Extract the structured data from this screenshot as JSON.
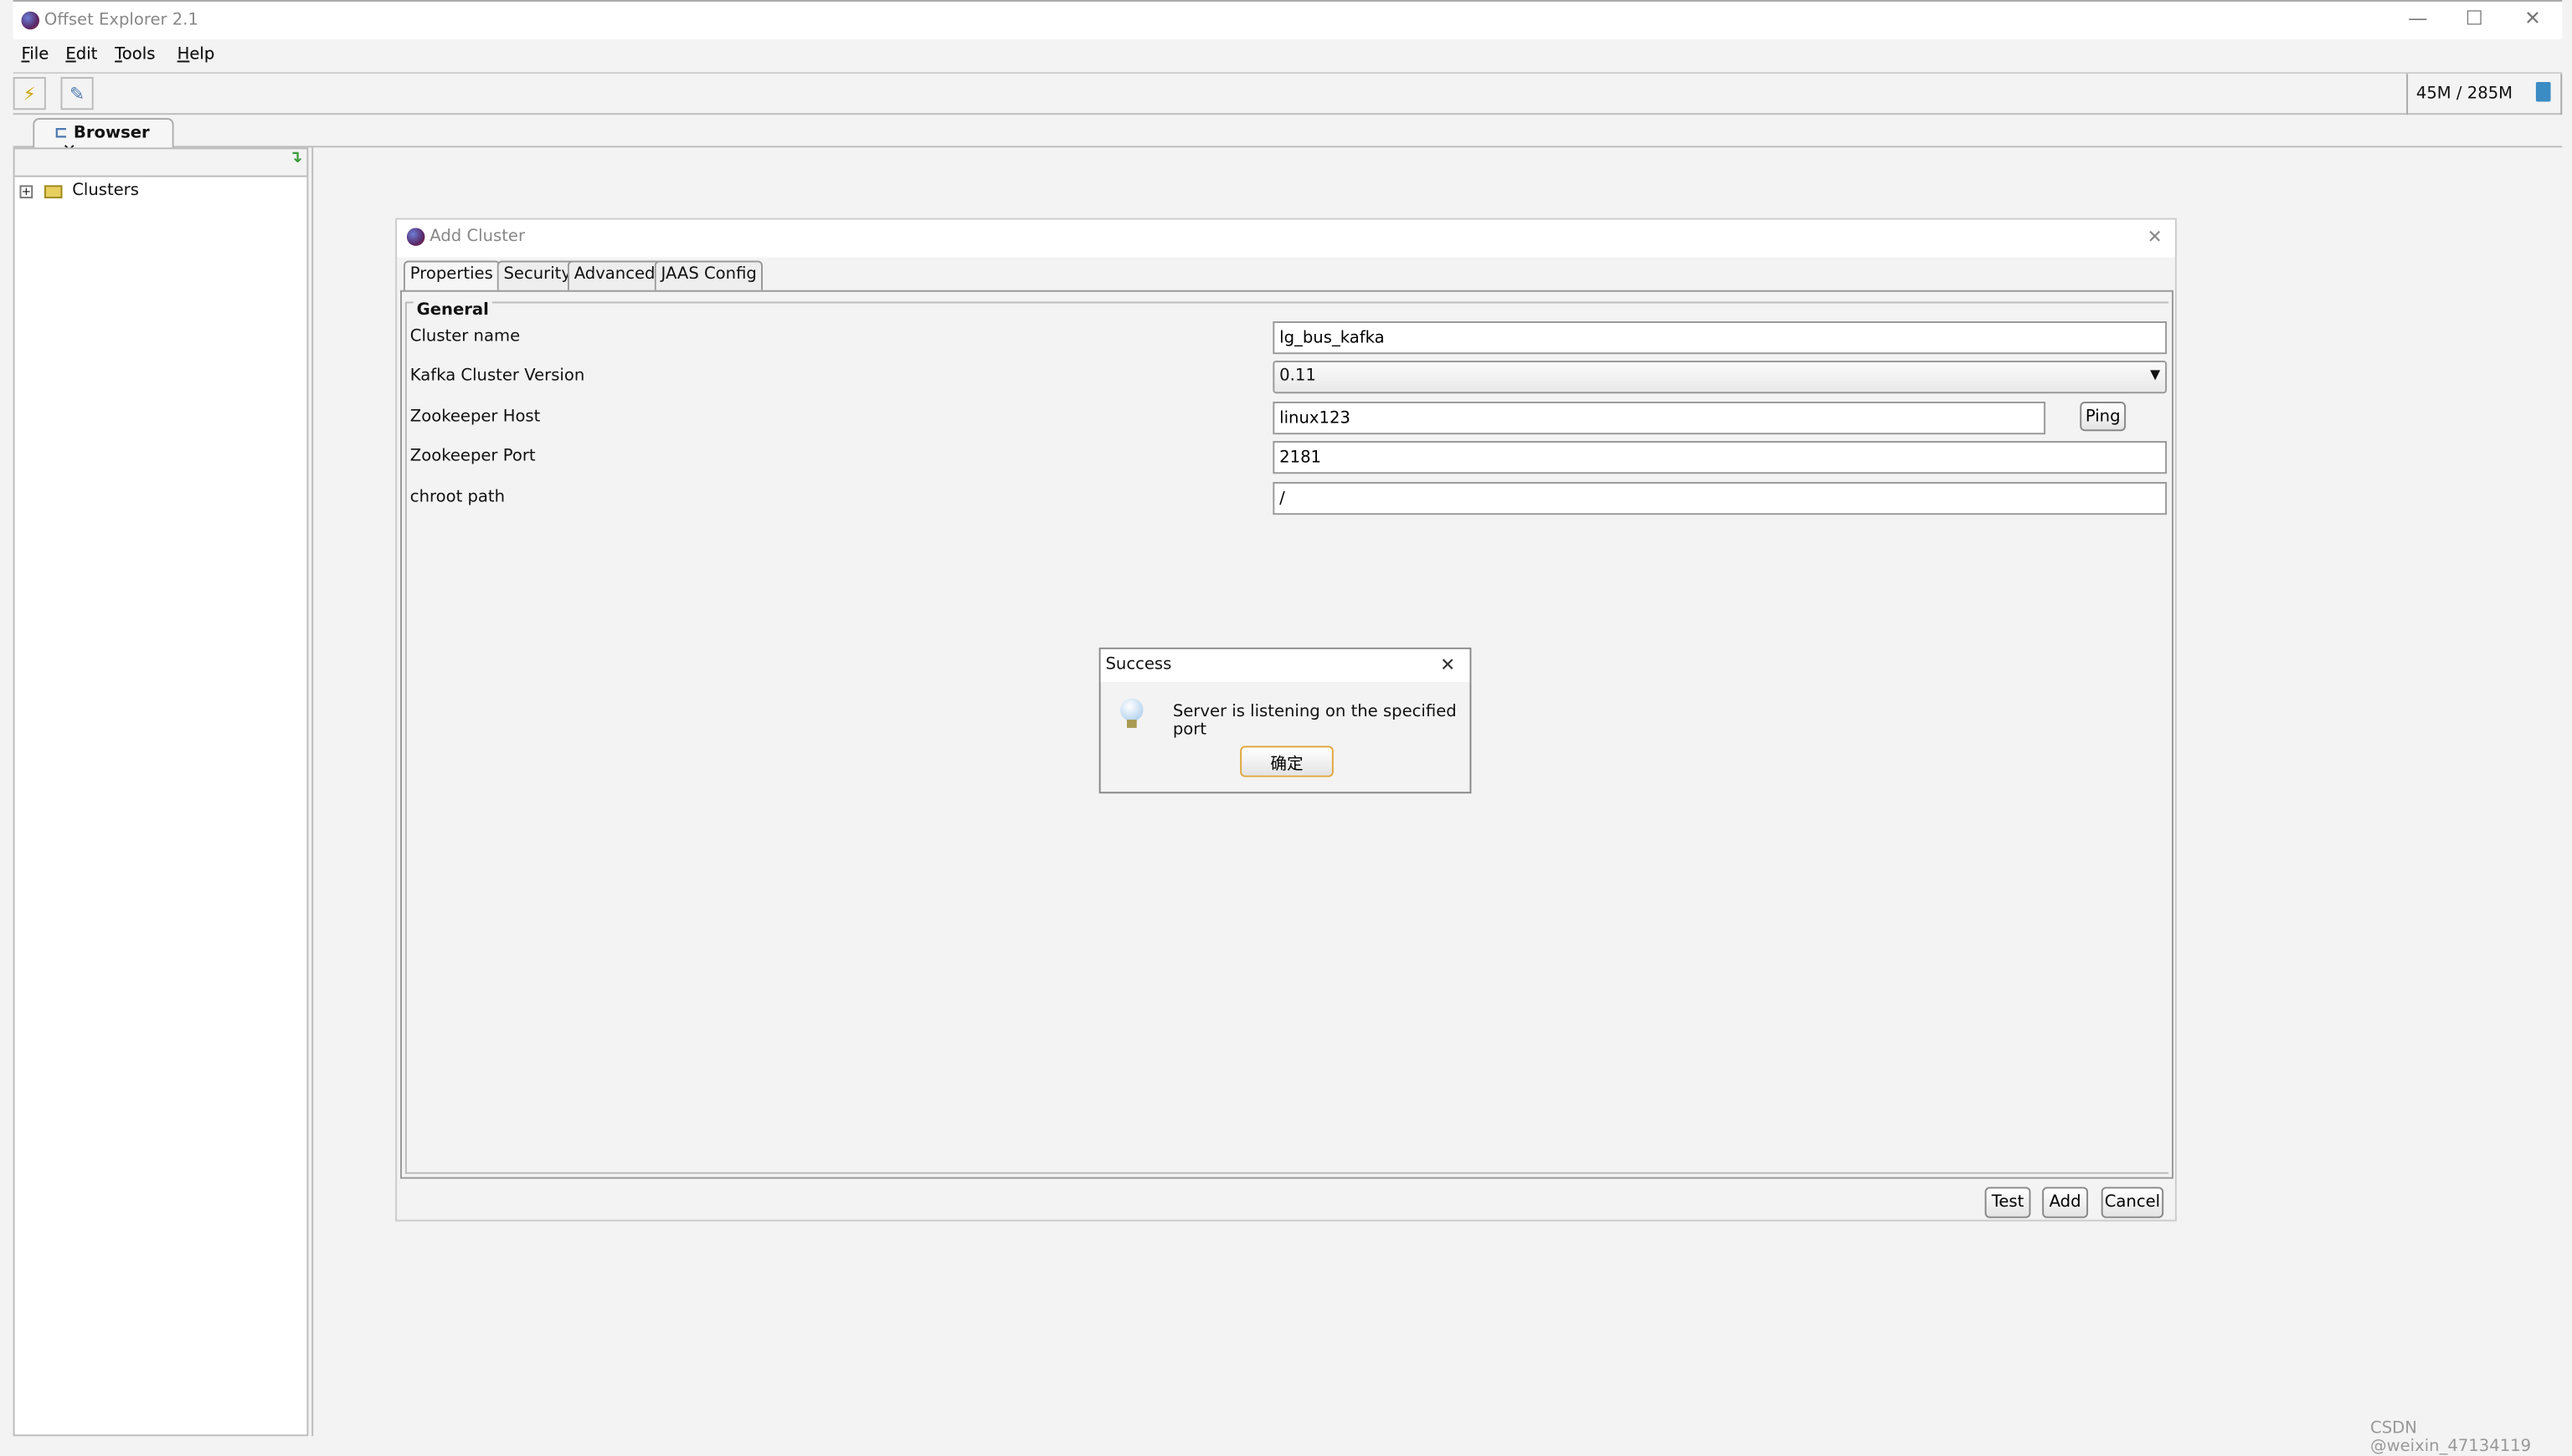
{
  "window": {
    "title": "Offset Explorer  2.1",
    "minimize_icon": "minimize-icon",
    "maximize_icon": "maximize-icon",
    "close_icon": "close-icon"
  },
  "menu": [
    {
      "label": "File",
      "mnemonic": "F",
      "rest": "ile"
    },
    {
      "label": "Edit",
      "mnemonic": "E",
      "rest": "dit"
    },
    {
      "label": "Tools",
      "mnemonic": "T",
      "rest": "ools"
    },
    {
      "label": "Help",
      "mnemonic": "H",
      "rest": "elp"
    }
  ],
  "toolbar": {
    "memory": "45M / 285M",
    "buttons": [
      "add-connection-icon",
      "edit-tree-icon"
    ]
  },
  "tabs": {
    "browser": "Browser"
  },
  "tree": {
    "root": "Clusters"
  },
  "add_cluster": {
    "title": "Add Cluster",
    "tabs": [
      "Properties",
      "Security",
      "Advanced",
      "JAAS Config"
    ],
    "active_tab": "Properties",
    "group": "General",
    "fields": {
      "cluster_name": {
        "label": "Cluster name",
        "value": "lg_bus_kafka"
      },
      "version": {
        "label": "Kafka Cluster Version",
        "value": "0.11"
      },
      "zk_host": {
        "label": "Zookeeper Host",
        "value": "linux123"
      },
      "zk_port": {
        "label": "Zookeeper Port",
        "value": "2181"
      },
      "chroot": {
        "label": "chroot path",
        "value": "/"
      }
    },
    "ping": "Ping",
    "test": "Test",
    "add": "Add",
    "cancel": "Cancel"
  },
  "success": {
    "title": "Success",
    "message": "Server is listening on the specified port",
    "ok": "确定"
  },
  "watermark": "CSDN @weixin_47134119"
}
